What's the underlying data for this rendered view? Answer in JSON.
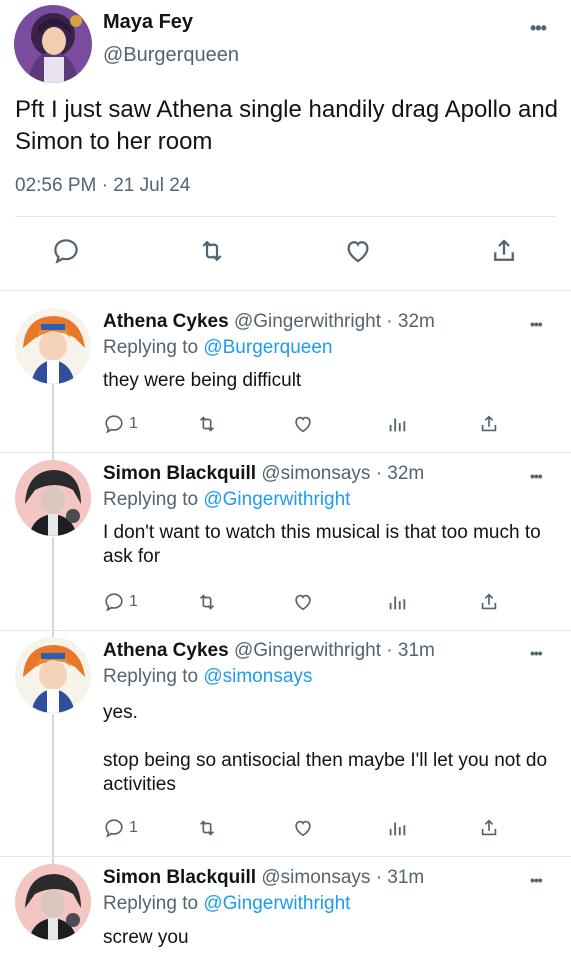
{
  "main_tweet": {
    "display_name": "Maya Fey",
    "handle": "@Burgerqueen",
    "text": "Pft I just saw Athena single handily drag Apollo and Simon to her room",
    "timestamp": "02:56 PM · 21 Jul 24",
    "avatar_icon": "purple-hair-girl-avatar",
    "more_icon": "more-dots-icon"
  },
  "actions": {
    "reply_icon": "reply-icon",
    "retweet_icon": "retweet-icon",
    "like_icon": "heart-icon",
    "share_icon": "share-icon",
    "views_icon": "views-icon"
  },
  "replies": [
    {
      "display_name": "Athena Cykes",
      "meta": "@Gingerwithright · 32m",
      "replying_prefix": "Replying to",
      "replying_to": "@Burgerqueen",
      "text": "they were being difficult",
      "reply_count": "1",
      "avatar_icon": "orange-hair-girl-avatar"
    },
    {
      "display_name": "Simon Blackquill",
      "meta": "@simonsays · 32m",
      "replying_prefix": "Replying to",
      "replying_to": "@Gingerwithright",
      "text": "I don't want to watch this musical is that too much to ask for",
      "reply_count": "1",
      "avatar_icon": "dark-hair-man-avatar"
    },
    {
      "display_name": "Athena Cykes",
      "meta": "@Gingerwithright · 31m",
      "replying_prefix": "Replying to",
      "replying_to": "@simonsays",
      "text_line1": "yes.",
      "text_line2": "stop being so antisocial then maybe I'll let you not do activities",
      "reply_count": "1",
      "avatar_icon": "orange-hair-girl-avatar"
    },
    {
      "display_name": "Simon Blackquill",
      "meta": "@simonsays · 31m",
      "replying_prefix": "Replying to",
      "replying_to": "@Gingerwithright",
      "text": "screw you",
      "avatar_icon": "dark-hair-man-avatar"
    }
  ],
  "colors": {
    "link": "#1d9bf0",
    "secondary_text": "#536471",
    "divider": "#e1e6ea"
  }
}
